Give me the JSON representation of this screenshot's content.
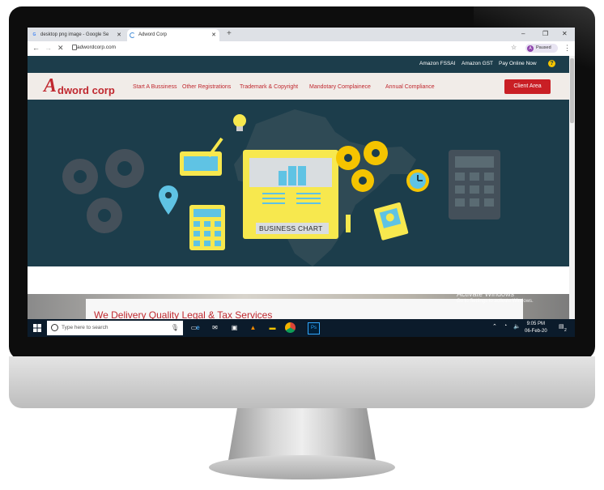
{
  "browser": {
    "tabs": [
      {
        "label": "desktop png image - Google Se",
        "favicon": "google-g-icon"
      },
      {
        "label": "Adword Corp",
        "favicon": "loading-icon"
      }
    ],
    "new_tab": "+",
    "window_controls": [
      "–",
      "❐",
      "✕"
    ],
    "url": "adwordcorp.com",
    "profile_initial": "A",
    "profile_status": "Paused",
    "menu": "⋮"
  },
  "site": {
    "top_links": [
      "Amazon FSSAI",
      "Amazon GST",
      "Pay Online Now"
    ],
    "help": "?",
    "logo_a": "A",
    "logo_rest": "dword corp",
    "nav": [
      "Start A Bussiness",
      "Other Registrations",
      "Trademark & Copyright",
      "Mandotary Complainece",
      "Annual Compliance"
    ],
    "client_button": "Client Area",
    "hero_caption": "BUSINESS CHART",
    "tagline": "We Delivery Quality Legal & Tax Services"
  },
  "watermark": {
    "line1": "Activate Windows",
    "line2": "Go to Settings to activate Windows."
  },
  "taskbar": {
    "search_placeholder": "Type here to search",
    "time": "9:05 PM",
    "date": "06-Feb-20",
    "notifications": "2",
    "apps": [
      "task-view-icon",
      "edge-icon",
      "mail-icon",
      "store-icon",
      "vlc-icon",
      "file-explorer-icon",
      "chrome-icon",
      "photoshop-icon"
    ]
  },
  "colors": {
    "brand_red": "#c0282f",
    "hero_bg": "#1c3d4b",
    "accent_yellow": "#f5c400"
  }
}
